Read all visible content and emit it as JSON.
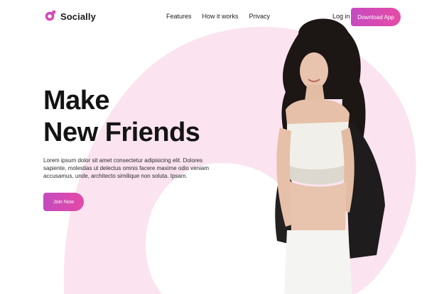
{
  "nav": {
    "brand": "Socially",
    "links": [
      "Features",
      "How it works",
      "Privacy"
    ],
    "login": "Log in",
    "download": "Download App"
  },
  "hero": {
    "title_line1": "Make",
    "title_line2": "New Friends",
    "text": "Lorem ipsum dolor sit amet consectetur adipisicing elit. Dolores sapiente, molestias ut delectus omnis facere maxime odio veniam accusamus, unde, architecto similique non soluta. Ipsam.",
    "cta": "Join Now"
  },
  "colors": {
    "accent_start": "#c64ac1",
    "accent_end": "#e64ba7",
    "shape": "#fbe3ef",
    "text": "#141414"
  },
  "icons": [
    "socially-logo-icon"
  ]
}
